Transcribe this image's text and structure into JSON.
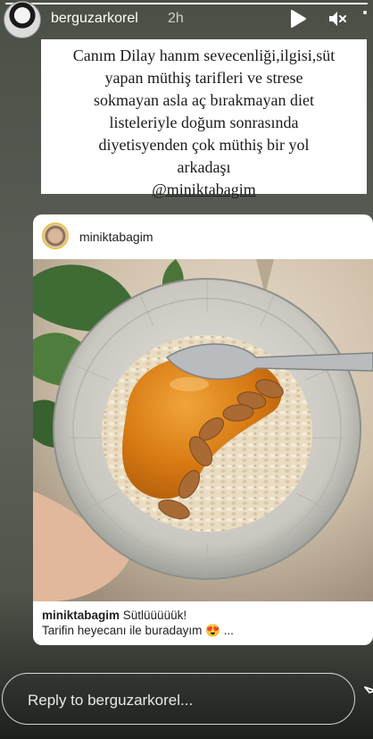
{
  "story": {
    "progress": 1.0,
    "username": "berguzarkorel",
    "timestamp": "2h",
    "icons": {
      "play": "play-icon",
      "mute": "speaker-muted-icon",
      "more": "more-icon"
    }
  },
  "caption": {
    "line1": "Canım Dilay hanım sevecenliği,ilgisi,süt",
    "line2": "yapan müthiş tarifleri ve strese",
    "line3": "sokmayan asla aç bırakmayan diet",
    "line4": "listeleriyle doğum sonrasında",
    "line5": "diyetisyenden çok müthiş bir yol",
    "line6": "arkadaşı",
    "mention": "@miniktabagim"
  },
  "post": {
    "username": "miniktabagim",
    "caption_user": "miniktabagim",
    "caption_text": " Sütlüüüüük!",
    "caption_line2": "Tarifin heyecanı ile buradayım ",
    "caption_ellipsis": " ...",
    "emoji": "😍"
  },
  "reply": {
    "placeholder": "Reply to berguzarkorel..."
  },
  "colors": {
    "background_top": "#4a5046",
    "background_bottom": "#1d1f1c",
    "card": "#ffffff",
    "text_light": "#ffffff"
  }
}
